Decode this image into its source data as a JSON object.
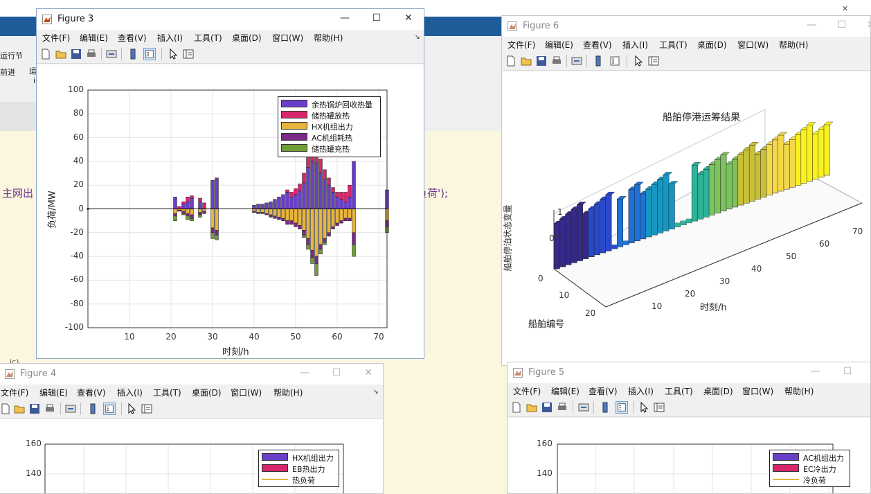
{
  "background": {
    "ribbon_lines": [
      "运行节",
      "前进",
      "运",
      "i"
    ],
    "code_left": "主网出",
    "code_right": "负荷');",
    "small_tag": "ic)"
  },
  "menus": [
    "文件(F)",
    "编辑(E)",
    "查看(V)",
    "插入(I)",
    "工具(T)",
    "桌面(D)",
    "窗口(W)",
    "帮助(H)"
  ],
  "window_controls": {
    "minimize": "—",
    "maximize": "☐",
    "close": "✕"
  },
  "fig3": {
    "title": "Figure 3",
    "chart_data": {
      "type": "bar",
      "stacked": true,
      "title": "",
      "xlabel": "时刻/h",
      "ylabel": "负荷/MW",
      "xlim": [
        0,
        72
      ],
      "ylim": [
        -100,
        100
      ],
      "xticks": [
        10,
        20,
        30,
        40,
        50,
        60,
        70
      ],
      "yticks": [
        100,
        80,
        60,
        40,
        20,
        0,
        -20,
        -40,
        -60,
        -80,
        -100
      ],
      "grid": true,
      "legend_position": "top-right",
      "legend": [
        "余热锅炉回收热量",
        "储热罐放热",
        "HX机组出力",
        "AC机组耗热",
        "储热罐充热"
      ],
      "colors": [
        "#6a3fc8",
        "#d7266b",
        "#e8b43c",
        "#7a2a86",
        "#6e9e35"
      ],
      "x": [
        21,
        22,
        23,
        24,
        25,
        27,
        28,
        30,
        31,
        40,
        41,
        42,
        43,
        44,
        45,
        46,
        47,
        48,
        49,
        50,
        51,
        52,
        53,
        54,
        55,
        56,
        57,
        58,
        59,
        60,
        61,
        62,
        63,
        64,
        72
      ],
      "series": [
        {
          "name": "余热锅炉回收热量",
          "values": [
            10,
            0,
            4,
            6,
            9,
            6,
            0,
            24,
            26,
            3,
            4,
            4,
            5,
            6,
            8,
            10,
            12,
            14,
            10,
            12,
            15,
            22,
            35,
            40,
            38,
            30,
            25,
            20,
            14,
            10,
            8,
            6,
            10,
            40,
            16
          ]
        },
        {
          "name": "储热罐放热",
          "values": [
            0,
            2,
            2,
            4,
            2,
            3,
            5,
            0,
            0,
            0,
            0,
            0,
            0,
            0,
            0,
            0,
            0,
            2,
            4,
            5,
            6,
            8,
            10,
            20,
            14,
            12,
            8,
            6,
            4,
            4,
            6,
            8,
            10,
            0,
            0
          ]
        },
        {
          "name": "HX机组出力",
          "values": [
            -4,
            -1,
            -2,
            -4,
            -5,
            -3,
            -2,
            -16,
            -18,
            -2,
            -3,
            -3,
            -4,
            -5,
            -6,
            -7,
            -8,
            -10,
            -10,
            -12,
            -14,
            -18,
            -25,
            -35,
            -40,
            -30,
            -25,
            -20,
            -15,
            -12,
            -10,
            -8,
            -8,
            -20,
            -10
          ]
        },
        {
          "name": "AC机组耗热",
          "values": [
            -2,
            -1,
            -2,
            -2,
            -3,
            -2,
            -2,
            -4,
            -4,
            -1,
            -1,
            -1,
            -1,
            -2,
            -2,
            -2,
            -2,
            -3,
            -3,
            -3,
            -3,
            -4,
            -5,
            -6,
            -6,
            -4,
            -3,
            -3,
            -2,
            -2,
            -2,
            -2,
            -2,
            -10,
            -5
          ]
        },
        {
          "name": "储热罐充热",
          "values": [
            -4,
            0,
            -1,
            -3,
            -2,
            -2,
            0,
            -5,
            -4,
            0,
            0,
            0,
            0,
            0,
            0,
            0,
            0,
            0,
            0,
            0,
            0,
            -2,
            -4,
            -5,
            -10,
            -4,
            -2,
            0,
            0,
            0,
            0,
            0,
            0,
            -10,
            -5
          ]
        }
      ]
    }
  },
  "fig6": {
    "title": "Figure 6",
    "chart_data": {
      "type": "bar3d",
      "title": "船舶停港运筹结果",
      "xlabel": "时刻/h",
      "ylabel": "船舶编号",
      "zlabel": "船舶停泊状态变量",
      "xticks": [
        10,
        20,
        30,
        40,
        50,
        60,
        70
      ],
      "yticks": [
        0,
        10,
        20
      ],
      "zticks": [
        0,
        0.5,
        1
      ],
      "colormap": "parula"
    }
  },
  "fig4": {
    "title": "Figure 4",
    "chart_data": {
      "type": "line",
      "yticks": [
        160,
        140
      ],
      "legend": [
        "HX机组出力",
        "EB热出力",
        "热负荷"
      ],
      "colors": [
        "#6a3fc8",
        "#d7266b",
        "#e8b43c"
      ]
    }
  },
  "fig5": {
    "title": "Figure 5",
    "chart_data": {
      "type": "line",
      "yticks": [
        160,
        140
      ],
      "legend": [
        "AC机组出力",
        "EC冷出力",
        "冷负荷"
      ],
      "colors": [
        "#6a3fc8",
        "#d7266b",
        "#e8b43c"
      ]
    }
  }
}
